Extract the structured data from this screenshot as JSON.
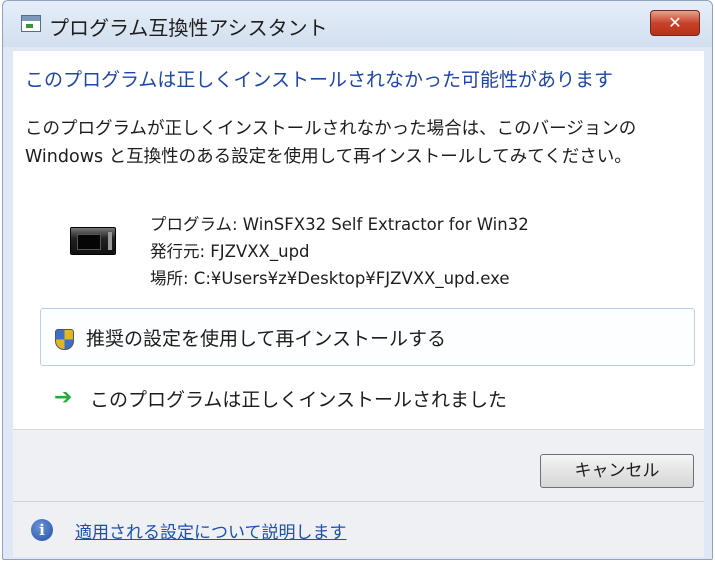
{
  "window": {
    "title": "プログラム互換性アシスタント",
    "close_label": "✕"
  },
  "main": {
    "heading": "このプログラムは正しくインストールされなかった可能性があります",
    "description": "このプログラムが正しくインストールされなかった場合は、このバージョンの Windows と互換性のある設定を使用して再インストールしてみてください。",
    "program_line": "プログラム: WinSFX32 Self Extractor for Win32",
    "publisher_line": "発行元: FJZVXX_upd",
    "location_line": "場所: C:¥Users¥z¥Desktop¥FJZVXX_upd.exe"
  },
  "options": {
    "recommended_label": "推奨の設定を使用して再インストールする",
    "success_label": "このプログラムは正しくインストールされました"
  },
  "buttons": {
    "cancel_label": "キャンセル"
  },
  "footer": {
    "help_icon_glyph": "i",
    "help_link_label": "適用される設定について説明します"
  },
  "icons": {
    "app": "program-icon",
    "close": "close-icon",
    "shield": "shield-icon",
    "arrow": "green-arrow-icon",
    "info": "info-icon"
  }
}
